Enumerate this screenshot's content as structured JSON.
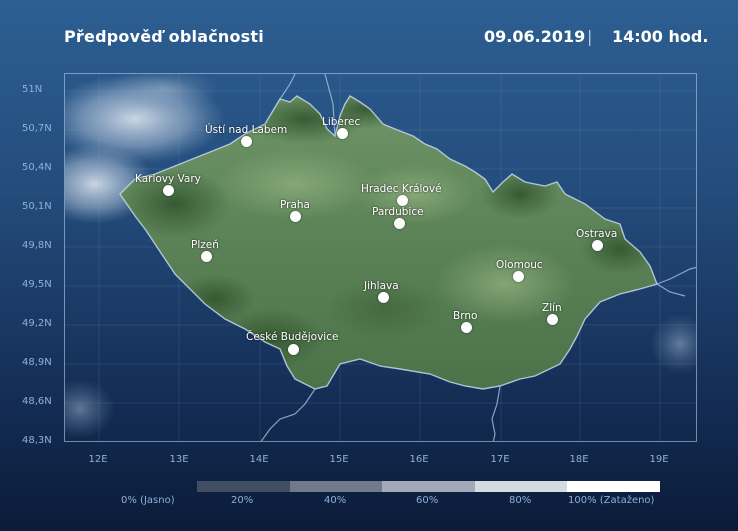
{
  "header": {
    "title": "Předpověď oblačnosti",
    "date": "09.06.2019",
    "separator": "|",
    "time": "14:00 hod."
  },
  "map": {
    "latitude_labels": [
      "51N",
      "50,7N",
      "50,4N",
      "50,1N",
      "49,8N",
      "49,5N",
      "49,2N",
      "48,9N",
      "48,6N",
      "48,3N"
    ],
    "longitude_labels": [
      "12E",
      "13E",
      "14E",
      "15E",
      "16E",
      "17E",
      "18E",
      "19E"
    ],
    "cities": [
      {
        "name": "Liberec"
      },
      {
        "name": "Ústí nad Labem"
      },
      {
        "name": "Karlovy Vary"
      },
      {
        "name": "Hradec Králové"
      },
      {
        "name": "Praha"
      },
      {
        "name": "Pardubice"
      },
      {
        "name": "Ostrava"
      },
      {
        "name": "Plzeň"
      },
      {
        "name": "Olomouc"
      },
      {
        "name": "Jihlava"
      },
      {
        "name": "Brno"
      },
      {
        "name": "Zlín"
      },
      {
        "name": "České Budějovice"
      }
    ]
  },
  "legend": {
    "labels": [
      "0% (Jasno)",
      "20%",
      "40%",
      "60%",
      "80%",
      "100% (Zataženo)"
    ],
    "colors": [
      "#414d63",
      "#6f7a8d",
      "#a3abb9",
      "#d6dbe2",
      "#ffffff"
    ]
  }
}
